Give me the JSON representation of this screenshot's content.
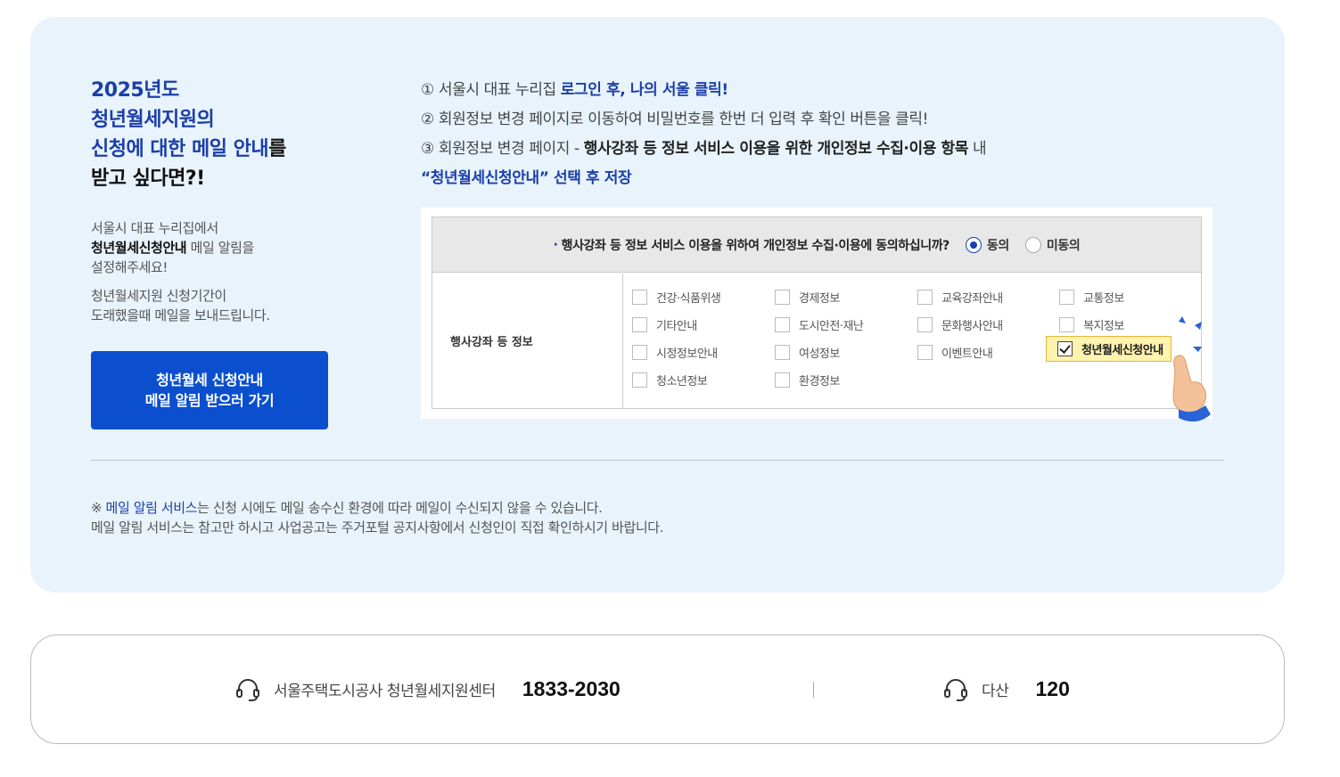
{
  "left": {
    "title_line1": "2025년도",
    "title_line2": "청년월세지원의",
    "title_line3_blue": "신청에 대한 메일 안내",
    "title_line3_rest": "를",
    "title_line4": "받고 싶다면?!",
    "desc1_line1": "서울시 대표 누리집에서",
    "desc1_bold": "청년월세신청안내",
    "desc1_rest": " 메일 알림을",
    "desc1_line3": "설정해주세요!",
    "desc2_line1": "청년월세지원 신청기간이",
    "desc2_line2": "도래했을때 메일을 보내드립니다.",
    "cta_line1": "청년월세 신청안내",
    "cta_line2": "메일 알림 받으러 가기"
  },
  "steps": {
    "s1_prefix": "① 서울시 대표 누리집 ",
    "s1_bold": "로그인 후, 나의 서울 클릭!",
    "s2": "② 회원정보 변경 페이지로 이동하여 비밀번호를 한번 더 입력 후 확인 버튼을 클릭!",
    "s3_prefix": "③ 회원정보 변경 페이지 - ",
    "s3_bold": "행사강좌 등 정보 서비스 이용을 위한 개인정보 수집·이용 항목",
    "s3_suffix": " 내",
    "s4_bold": "“청년월세신청안내” 선택 후 저장"
  },
  "mock": {
    "question": "행사강좌 등 정보 서비스 이용을 위하여 개인정보 수집·이용에 동의하십니까?",
    "agree": "동의",
    "disagree": "미동의",
    "row_label": "행사강좌 등 정보",
    "options": {
      "o1": "건강·식품위생",
      "o2": "경제정보",
      "o3": "교육강좌안내",
      "o4": "교통정보",
      "o5": "기타안내",
      "o6": "도시안전·재난",
      "o7": "문화행사안내",
      "o8": "복지정보",
      "o9": "시정정보안내",
      "o10": "여성정보",
      "o11": "이벤트안내",
      "o12": "청년월세신청안내",
      "o13": "청소년정보",
      "o14": "환경정보"
    }
  },
  "note": {
    "prefix": "※ ",
    "blue": "메일 알림 서비스",
    "line1_rest": "는 신청 시에도 메일 송수신 환경에 따라 메일이 수신되지 않을 수 있습니다.",
    "line2": "메일 알림 서비스는 참고만 하시고 사업공고는 주거포털 공지사항에서 신청인이 직접 확인하시기 바랍니다."
  },
  "contact": {
    "c1_label": "서울주택도시공사 청년월세지원센터",
    "c1_number": "1833-2030",
    "c2_label": "다산",
    "c2_number": "120",
    "icon": "headset-icon"
  },
  "colors": {
    "panel_bg": "#e8f3fc",
    "accent_blue": "#1c3fa8",
    "cta_blue": "#0b4fcf"
  }
}
